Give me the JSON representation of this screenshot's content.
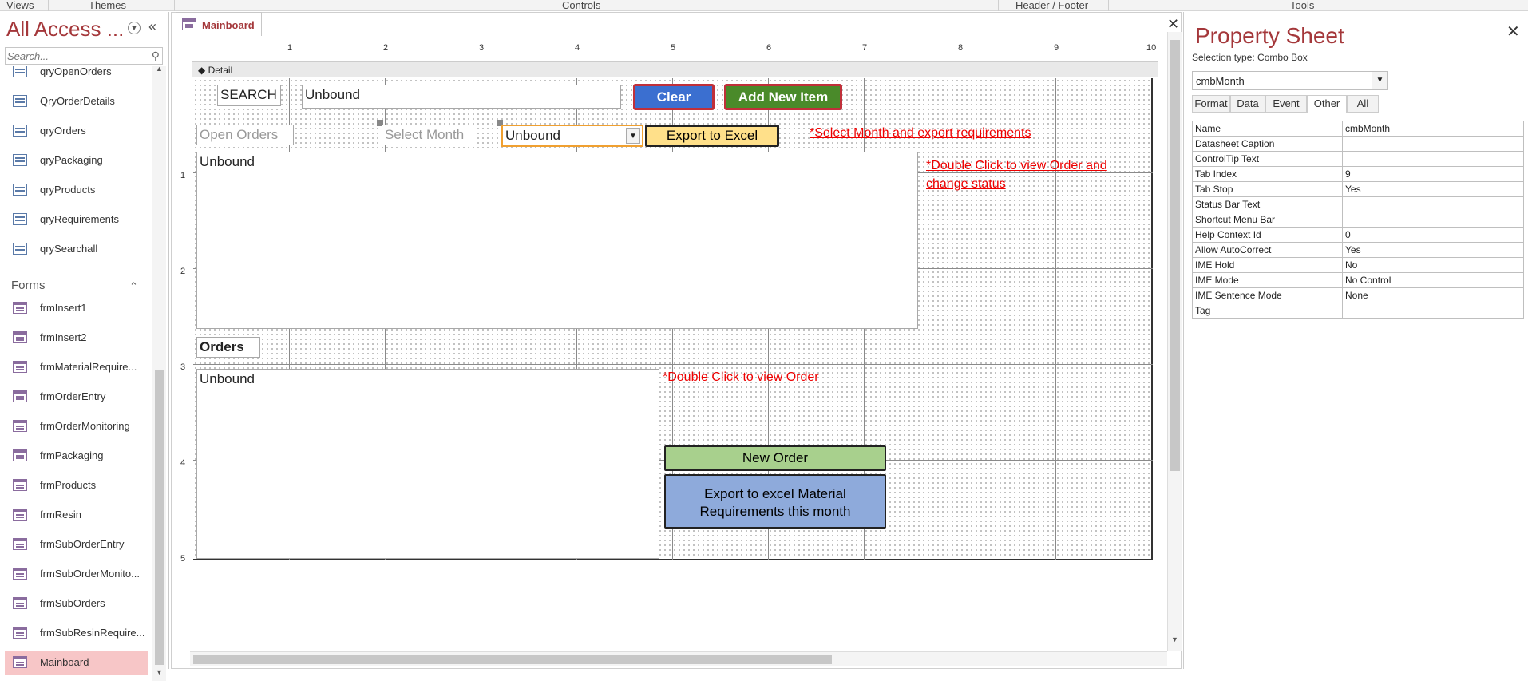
{
  "ribbon": {
    "groups": [
      "Views",
      "Themes",
      "Controls",
      "Header / Footer",
      "Tools"
    ]
  },
  "nav": {
    "title": "All Access ...",
    "search_placeholder": "Search...",
    "queries": [
      "qryOpenOrders",
      "QryOrderDetails",
      "qryOrders",
      "qryPackaging",
      "qryProducts",
      "qryRequirements",
      "qrySearchall"
    ],
    "forms_header": "Forms",
    "forms": [
      "frmInsert1",
      "frmInsert2",
      "frmMaterialRequire...",
      "frmOrderEntry",
      "frmOrderMonitoring",
      "frmPackaging",
      "frmProducts",
      "frmResin",
      "frmSubOrderEntry",
      "frmSubOrderMonito...",
      "frmSubOrders",
      "frmSubResinRequire...",
      "Mainboard"
    ]
  },
  "document": {
    "tab_label": "Mainboard",
    "close_glyph": "✕",
    "ruler_numbers": [
      "1",
      "2",
      "3",
      "4",
      "5",
      "6",
      "7",
      "8",
      "9",
      "10"
    ],
    "vruler_numbers": [
      "1",
      "2",
      "3",
      "4",
      "5"
    ],
    "section_label": "Detail"
  },
  "form": {
    "search_label": "SEARCH",
    "search_box": "Unbound",
    "clear_button": "Clear",
    "add_new_item_button": "Add New Item",
    "open_orders_label": "Open Orders",
    "select_month_label": "Select Month",
    "month_combo": "Unbound",
    "export_excel_button": "Export to Excel",
    "select_month_note": "*Select Month and export requirements",
    "open_orders_list": "Unbound",
    "double_click_note_1": "*Double Click to view Order and change status",
    "orders_label": "Orders",
    "orders_list": "Unbound",
    "double_click_note_2": "*Double Click to view Order",
    "new_order_button": "New Order",
    "export_material_button": "Export to excel Material Requirements this month"
  },
  "property_sheet": {
    "title": "Property Sheet",
    "selection_type": "Selection type:  Combo Box",
    "selected_control": "cmbMonth",
    "tabs": [
      "Format",
      "Data",
      "Event",
      "Other",
      "All"
    ],
    "active_tab": "Other",
    "rows": [
      {
        "k": "Name",
        "v": "cmbMonth"
      },
      {
        "k": "Datasheet Caption",
        "v": ""
      },
      {
        "k": "ControlTip Text",
        "v": ""
      },
      {
        "k": "Tab Index",
        "v": "9"
      },
      {
        "k": "Tab Stop",
        "v": "Yes"
      },
      {
        "k": "Status Bar Text",
        "v": ""
      },
      {
        "k": "Shortcut Menu Bar",
        "v": ""
      },
      {
        "k": "Help Context Id",
        "v": "0"
      },
      {
        "k": "Allow AutoCorrect",
        "v": "Yes"
      },
      {
        "k": "IME Hold",
        "v": "No"
      },
      {
        "k": "IME Mode",
        "v": "No Control"
      },
      {
        "k": "IME Sentence Mode",
        "v": "None"
      },
      {
        "k": "Tag",
        "v": ""
      }
    ]
  },
  "colors": {
    "accent": "#a4373a",
    "clear_btn": "#3b6fd0",
    "add_btn": "#4a8a2a",
    "export_btn": "#ffe08a",
    "new_order_btn": "#a8d08d",
    "export_material_btn": "#8eaadb",
    "note_red": "#e00000"
  }
}
